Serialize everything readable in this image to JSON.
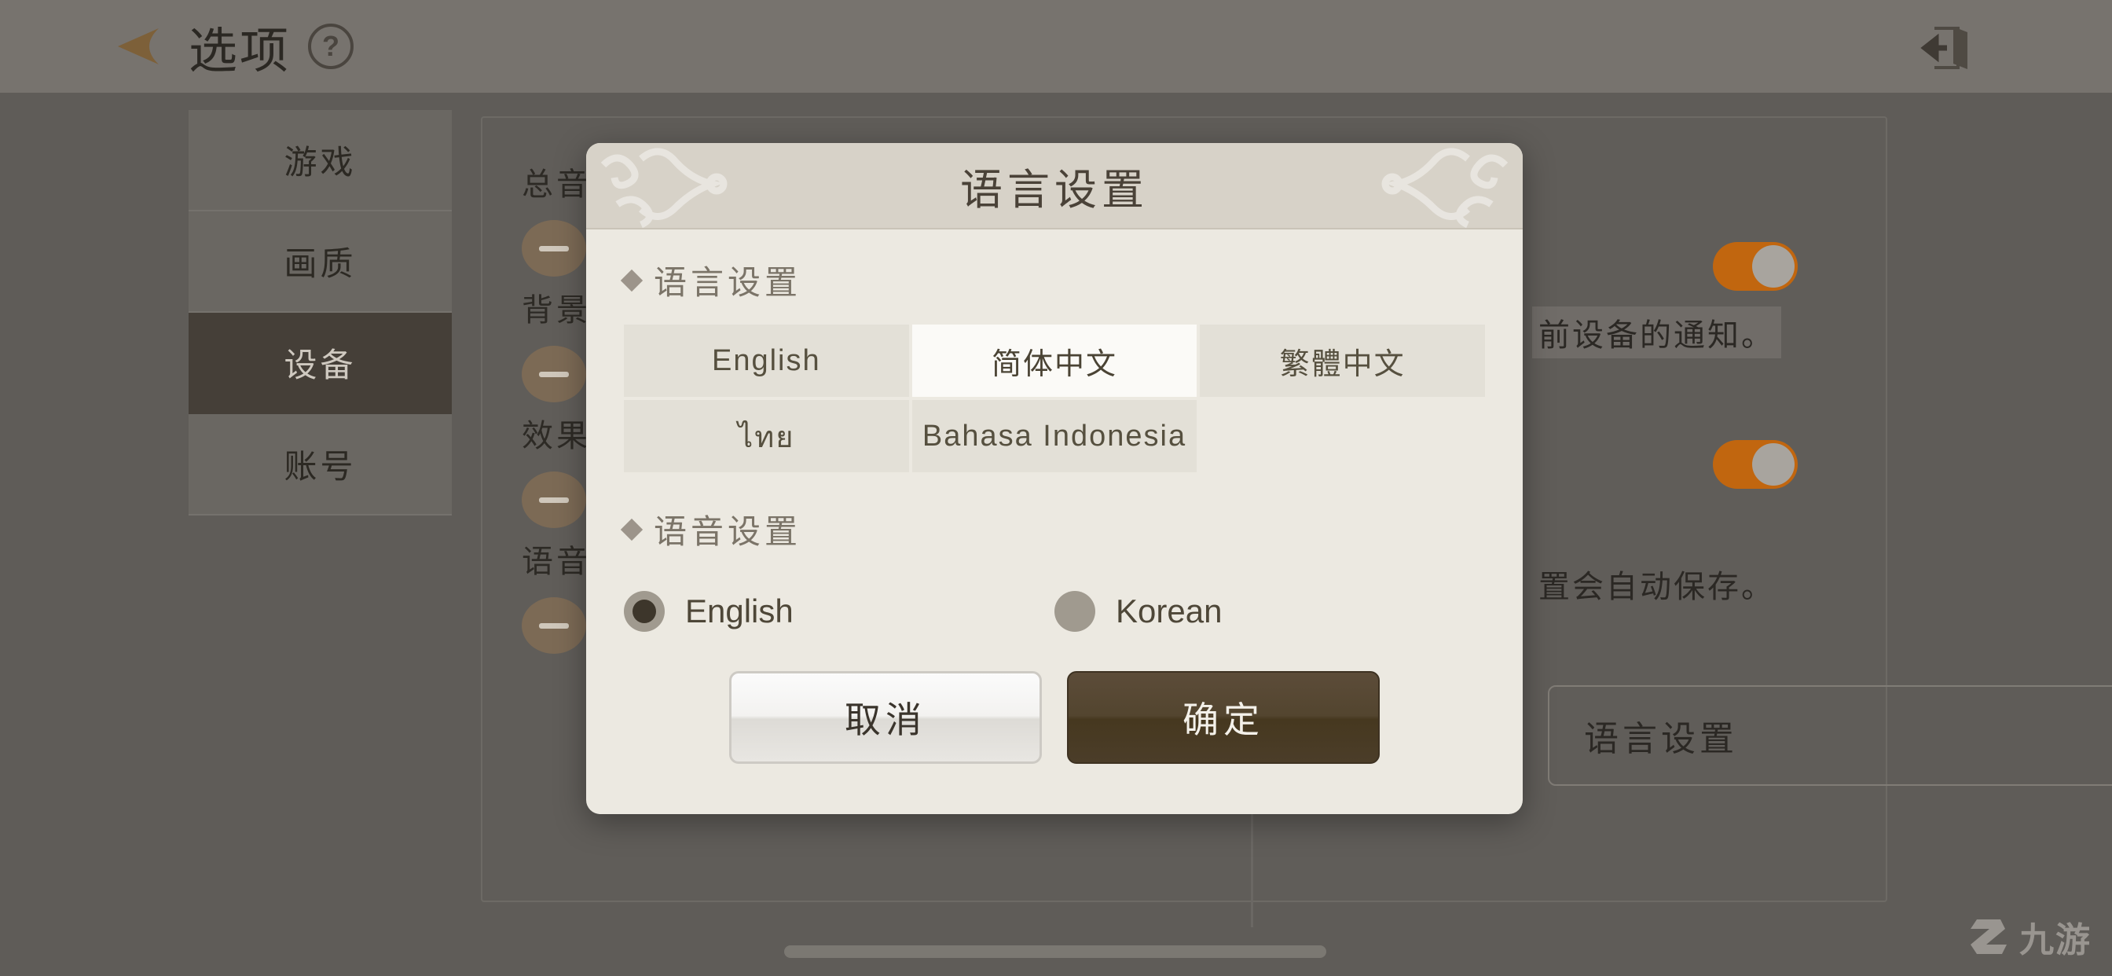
{
  "topbar": {
    "back_icon": "back-arrow-icon",
    "title": "选项",
    "help_icon": "?",
    "exit_icon": "exit-door-icon"
  },
  "sidebar": {
    "items": [
      {
        "label": "游戏",
        "active": false
      },
      {
        "label": "画质",
        "active": false
      },
      {
        "label": "设备",
        "active": true
      },
      {
        "label": "账号",
        "active": false
      }
    ]
  },
  "background_panel": {
    "volume_rows": [
      {
        "label": "总音",
        "minus_icon": "minus-icon"
      },
      {
        "label": "背景",
        "minus_icon": "minus-icon"
      },
      {
        "label": "效果",
        "minus_icon": "minus-icon"
      },
      {
        "label": "语音",
        "minus_icon": "minus-icon"
      }
    ],
    "notes": [
      "前设备的通知。",
      "置会自动保存。"
    ],
    "toggles": [
      {
        "state": "on"
      },
      {
        "state": "on"
      }
    ],
    "language_button_label": "语言设置"
  },
  "dialog": {
    "title": "语言设置",
    "ornament_icon": "cloud-swirl-ornament",
    "language_section": {
      "heading": "语言设置",
      "options": [
        {
          "label": "English",
          "selected": false
        },
        {
          "label": "简体中文",
          "selected": true
        },
        {
          "label": "繁體中文",
          "selected": false
        },
        {
          "label": "ไทย",
          "selected": false
        },
        {
          "label": "Bahasa Indonesia",
          "selected": false
        }
      ]
    },
    "voice_section": {
      "heading": "语音设置",
      "options": [
        {
          "label": "English",
          "selected": true
        },
        {
          "label": "Korean",
          "selected": false
        }
      ]
    },
    "actions": {
      "cancel_label": "取消",
      "confirm_label": "确定"
    }
  },
  "watermark": {
    "text": "九游"
  },
  "colors": {
    "accent_orange": "#c1660f",
    "confirm_brown": "#4b3d29",
    "dialog_bg": "#ece9e1",
    "dialog_header": "#d7d2c8",
    "selected_lang": "#fbfaf7",
    "sidebar_active": "#453f38"
  }
}
